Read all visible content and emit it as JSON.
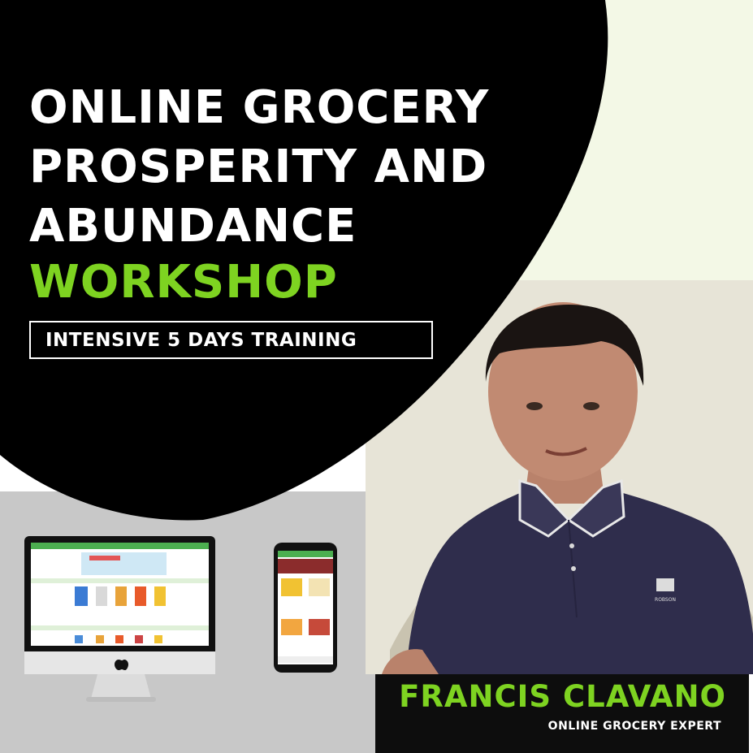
{
  "headline": {
    "lines": [
      "ONLINE GROCERY",
      "PROSPERITY AND",
      "ABUNDANCE"
    ],
    "accent": "WORKSHOP"
  },
  "badge": {
    "text": "INTENSIVE 5 DAYS TRAINING"
  },
  "presenter": {
    "name": "FRANCIS CLAVANO",
    "role": "ONLINE GROCERY EXPERT",
    "shirt_logo": "ROBSON"
  },
  "colors": {
    "accent": "#7ed321",
    "black": "#000000",
    "pale_green": "#f3f8e6",
    "grey_panel": "#c8c8c8",
    "shirt": "#2f2d4c"
  },
  "icons": [
    "apple-logo-icon"
  ]
}
